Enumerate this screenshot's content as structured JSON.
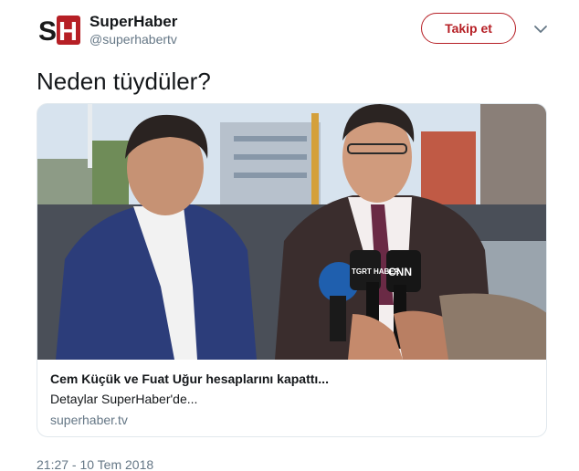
{
  "author": {
    "logo_text": "SH",
    "display_name": "SuperHaber",
    "handle": "@superhabertv"
  },
  "follow_button": {
    "label": "Takip et"
  },
  "icons": {
    "menu": "chevron-down-icon",
    "news_tag_1": "TGRT HABER",
    "news_tag_2": "CNN"
  },
  "tweet": {
    "text": "Neden tüydüler?",
    "timestamp": "21:27 - 10 Tem 2018"
  },
  "card": {
    "title": "Cem Küçük ve Fuat Uğur hesaplarını kapattı...",
    "description": "Detaylar SuperHaber'de...",
    "domain": "superhaber.tv",
    "image_alt": "Two men in suits speaking to press microphones outdoors"
  },
  "colors": {
    "accent": "#b61f25",
    "text": "#14171a",
    "secondary_text": "#657786",
    "border": "#e1e8ed"
  }
}
